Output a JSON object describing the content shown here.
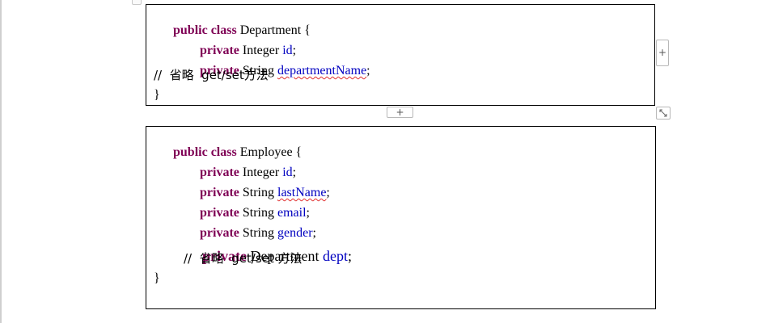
{
  "handles": {
    "add_row_glyph": "+",
    "add_col_glyph": "+",
    "resize_icon": "diagonal-resize-icon"
  },
  "department": {
    "line1": {
      "kw1": "public",
      "kw2": "class",
      "name": "Department {"
    },
    "line2": {
      "kw": "private",
      "type": "Integer",
      "field": "id",
      "end": ";"
    },
    "line3": {
      "kw": "private",
      "type": "String",
      "field": "departmentName",
      "end": ";"
    },
    "line4": {
      "comment": "//  省略  get/set方法"
    },
    "line5": {
      "close": "}"
    }
  },
  "employee": {
    "line1": {
      "kw1": "public",
      "kw2": "class",
      "name": "Employee {"
    },
    "line2": {
      "kw": "private",
      "type": "Integer",
      "field": "id",
      "end": ";"
    },
    "line3": {
      "kw": "private",
      "type": "String",
      "field": "lastName",
      "end": ";"
    },
    "line4": {
      "kw": "private",
      "type": "String",
      "field": "email",
      "end": ";"
    },
    "line5": {
      "kw": "private",
      "type": "String",
      "field": "gender",
      "end": ";"
    },
    "line6": {
      "kw": "private",
      "type": "Department",
      "field": "dept",
      "end": ";"
    },
    "line7": {
      "comment": "//  省略  get/set 方法"
    },
    "line8": {
      "close": "}"
    }
  }
}
